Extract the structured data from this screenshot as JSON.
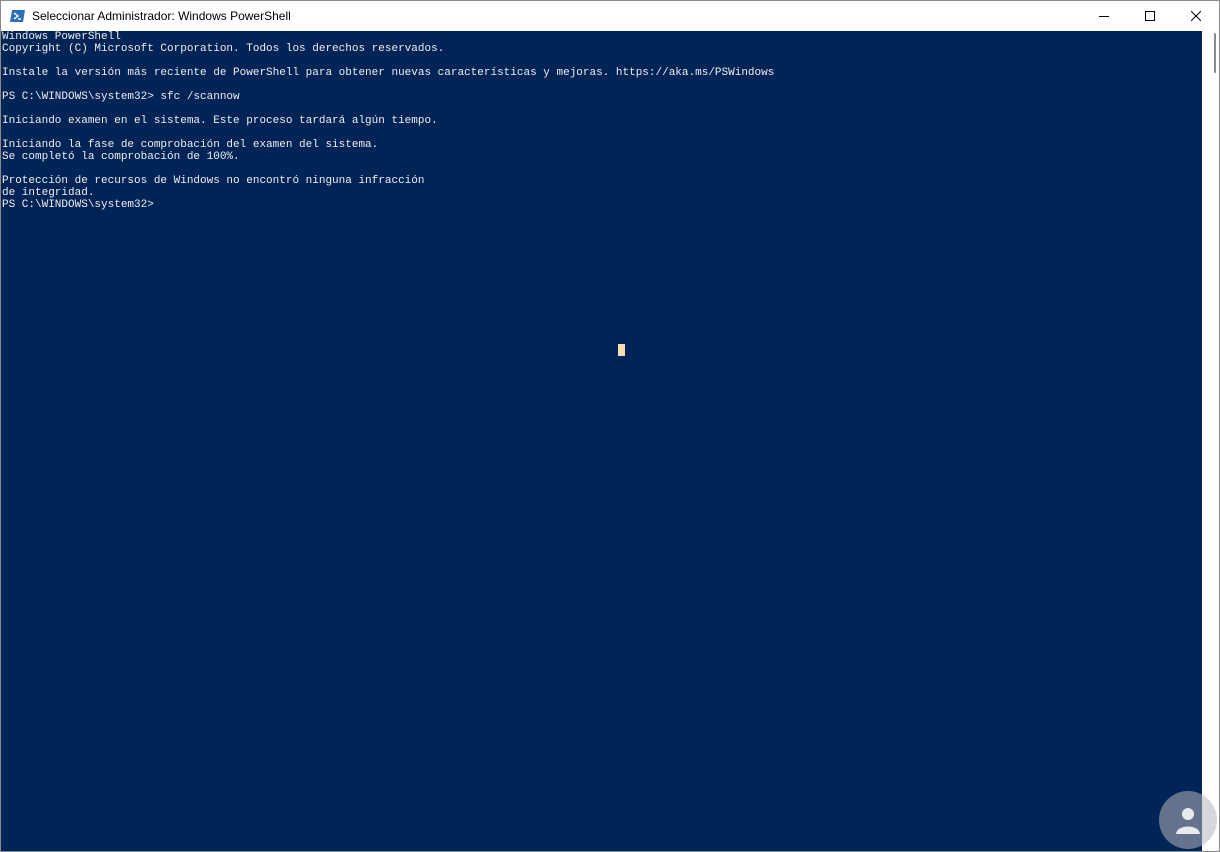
{
  "window": {
    "title": "Seleccionar Administrador: Windows PowerShell",
    "minimize_icon": "minimize-icon",
    "maximize_icon": "maximize-icon",
    "close_icon": "close-icon"
  },
  "console": {
    "background": "#012456",
    "foreground": "#eeedf0",
    "lines": [
      "Windows PowerShell",
      "Copyright (C) Microsoft Corporation. Todos los derechos reservados.",
      "",
      "Instale la versión más reciente de PowerShell para obtener nuevas características y mejoras. https://aka.ms/PSWindows",
      "",
      "PS C:\\WINDOWS\\system32> sfc /scannow",
      "",
      "Iniciando examen en el sistema. Este proceso tardará algún tiempo.",
      "",
      "Iniciando la fase de comprobación del examen del sistema.",
      "Se completó la comprobación de 100%.",
      "",
      "Protección de recursos de Windows no encontró ninguna infracción",
      "de integridad.",
      "PS C:\\WINDOWS\\system32>"
    ]
  },
  "colors": {
    "caret": "#fcdcb0"
  }
}
